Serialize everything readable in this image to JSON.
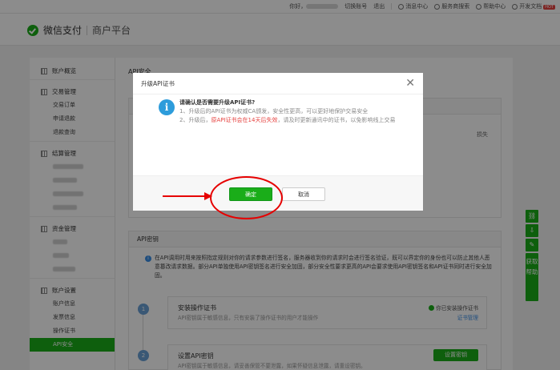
{
  "topbar": {
    "greeting": "你好，",
    "switch_account": "切换账号",
    "logout": "退出",
    "messages": "消息中心",
    "service_search": "服务商搜索",
    "help_center": "帮助中心",
    "dev_docs": "开发文档",
    "hot_badge": "HOT"
  },
  "header": {
    "brand": "微信支付",
    "platform": "商户平台"
  },
  "sidebar": {
    "overview": "账户概览",
    "trade_group": "交易管理",
    "trade_items": [
      "交易订单",
      "申请退款",
      "退款查询"
    ],
    "settle_group": "结算管理",
    "fund_group": "资金管理",
    "account_group": "账户设置",
    "account_items": [
      "账户信息",
      "发票信息",
      "操作证书",
      "API安全"
    ]
  },
  "main": {
    "title": "API安全",
    "bg_hint": "损失",
    "api_key_panel_title": "API密钥",
    "notice": "在API调用时用来按照指定规则对你的请求参数进行签名，服务器收到你的请求时会进行签名验证，既可以界定你的身份也可以防止其他人恶意篡改请求数据。部分API单独使用API密钥签名进行安全加固，部分安全性要求更高的API会要求使用API密钥签名和API证书同时进行安全加固。",
    "steps": [
      {
        "num": "1",
        "title": "安装操作证书",
        "desc": "API密钥属于敏感信息，只有安装了操作证书的用户才能操作",
        "status": "你已安装操作证书",
        "link": "证书管理"
      },
      {
        "num": "2",
        "title": "设置API密钥",
        "desc": "API密钥属于敏感信息，请妥善保管不要泄露，如果怀疑信息泄露，请重设密钥。",
        "button": "设置密钥"
      }
    ]
  },
  "tools": {
    "help": "获取帮助"
  },
  "modal": {
    "title": "升级API证书",
    "question": "请确认是否需要升级API证书?",
    "line1": "1、升级后的API证书为权威CA颁发，安全性更高，可以更好地保护交易安全",
    "line2_prefix": "2、升级后，",
    "line2_warn": "原API证书会在14天后失效",
    "line2_suffix": "，请及时更新通讯中的证书，以免影响线上交易",
    "ok": "确定",
    "cancel": "取消"
  },
  "colors": {
    "brand_green": "#1aad19",
    "info_blue": "#2d9cdb",
    "warn_red": "#e64340",
    "annotation_red": "#e60000"
  }
}
